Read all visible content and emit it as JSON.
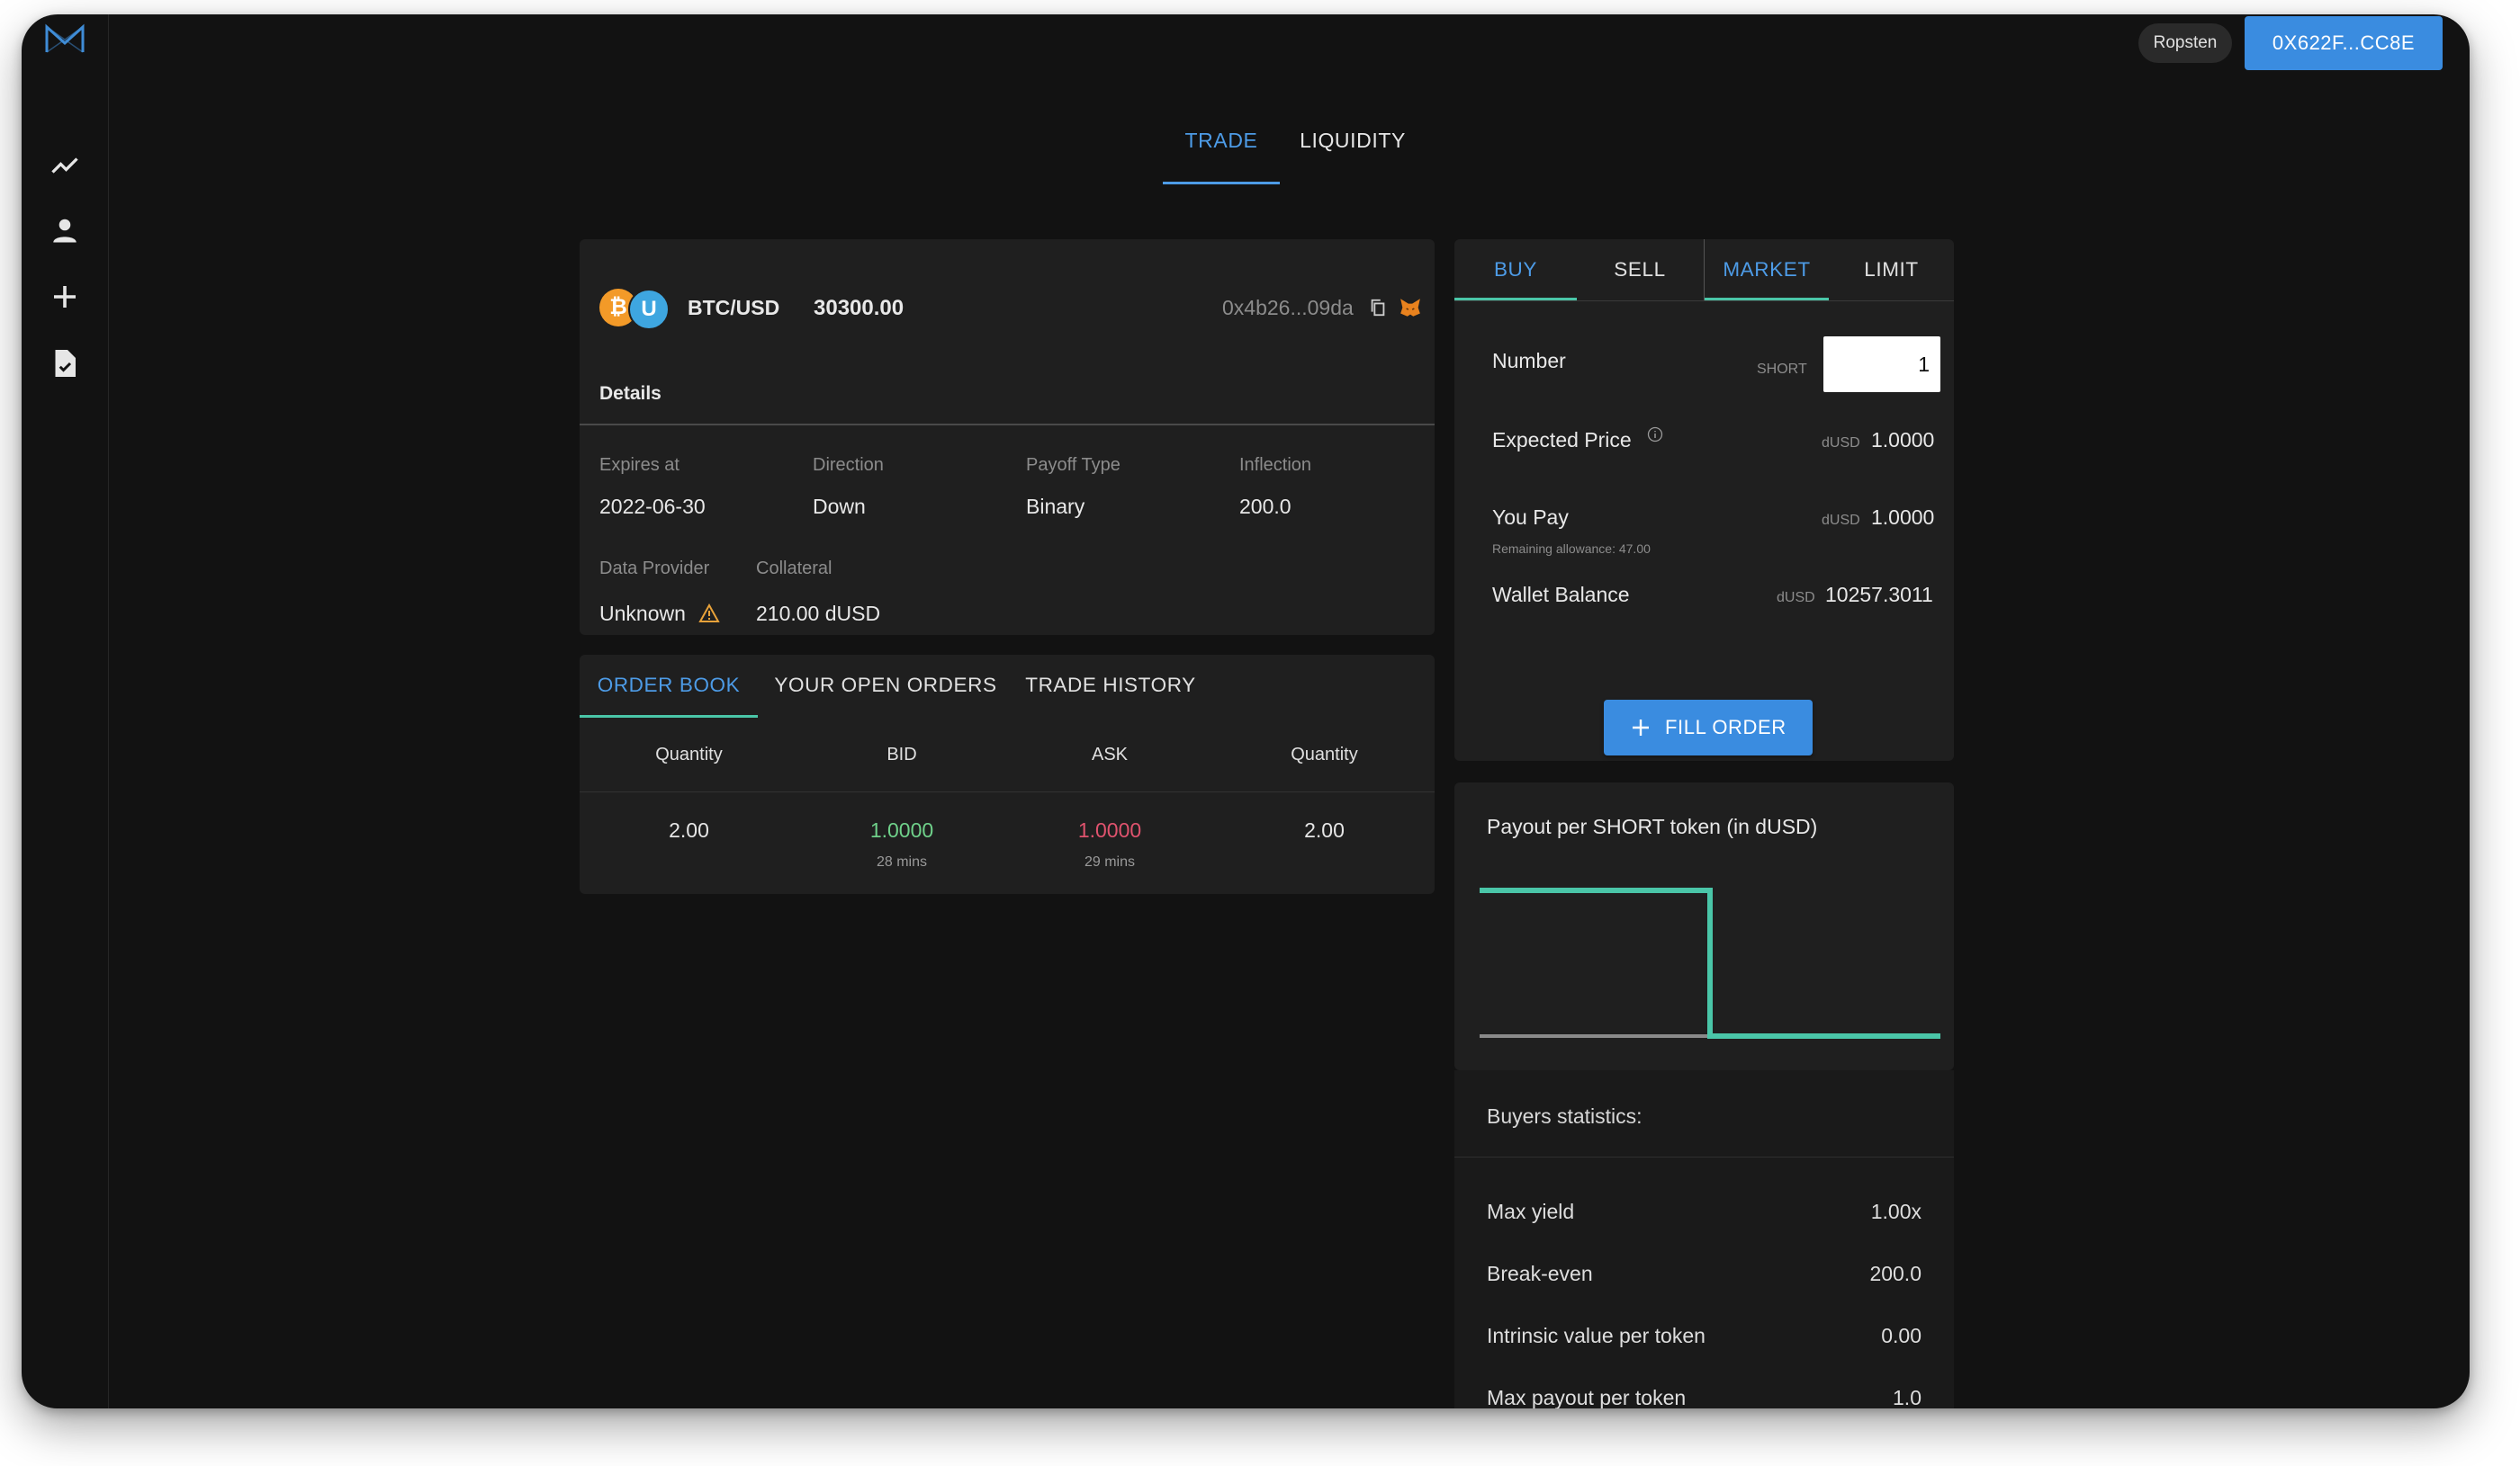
{
  "network": "Ropsten",
  "wallet_address": "0X622F...CC8E",
  "main_tabs": {
    "trade": "TRADE",
    "liquidity": "LIQUIDITY"
  },
  "pool": {
    "coin_a": "₿",
    "coin_b": "U",
    "pair": "BTC/USD",
    "price": "30300.00",
    "address": "0x4b26...09da",
    "details_title": "Details",
    "fields": {
      "expires_label": "Expires at",
      "expires_value": "2022-06-30",
      "direction_label": "Direction",
      "direction_value": "Down",
      "payoff_label": "Payoff Type",
      "payoff_value": "Binary",
      "inflection_label": "Inflection",
      "inflection_value": "200.0",
      "provider_label": "Data Provider",
      "provider_value": "Unknown",
      "collateral_label": "Collateral",
      "collateral_value": "210.00 dUSD"
    }
  },
  "order_tabs": {
    "book": "ORDER BOOK",
    "open": "YOUR OPEN ORDERS",
    "history": "TRADE HISTORY"
  },
  "order_book": {
    "headers": {
      "qty_bid": "Quantity",
      "bid": "BID",
      "ask": "ASK",
      "qty_ask": "Quantity"
    },
    "row": {
      "qty_bid": "2.00",
      "bid": "1.0000",
      "bid_time": "28 mins",
      "ask": "1.0000",
      "ask_time": "29 mins",
      "qty_ask": "2.00"
    }
  },
  "trade_panel": {
    "tabs": {
      "buy": "BUY",
      "sell": "SELL",
      "market": "MARKET",
      "limit": "LIMIT"
    },
    "number_label": "Number",
    "number_unit": "SHORT",
    "number_value": "1",
    "expected_label": "Expected Price",
    "expected_unit": "dUSD",
    "expected_value": "1.0000",
    "pay_label": "You Pay",
    "pay_unit": "dUSD",
    "pay_value": "1.0000",
    "allowance": "Remaining allowance: 47.00",
    "balance_label": "Wallet Balance",
    "balance_unit": "dUSD",
    "balance_value": "10257.3011",
    "fill_button": "FILL ORDER"
  },
  "payout": {
    "title": "Payout per SHORT token (in dUSD)"
  },
  "chart_data": {
    "type": "line",
    "title": "Payout per SHORT token (in dUSD)",
    "x": [
      0,
      200,
      200,
      400
    ],
    "values": [
      1,
      1,
      0,
      0
    ],
    "step_at": 200,
    "colors": {
      "line": "#4ac6a8",
      "axis": "#8a8a8a"
    }
  },
  "stats": {
    "title": "Buyers statistics:",
    "rows": [
      {
        "label": "Max yield",
        "value": "1.00x"
      },
      {
        "label": "Break-even",
        "value": "200.0"
      },
      {
        "label": "Intrinsic value per token",
        "value": "0.00"
      },
      {
        "label": "Max payout per token",
        "value": "1.0"
      }
    ]
  },
  "colors": {
    "accent": "#4d9be6",
    "bid": "#6fd18a",
    "ask": "#e0536e",
    "teal": "#4ac6a8"
  }
}
